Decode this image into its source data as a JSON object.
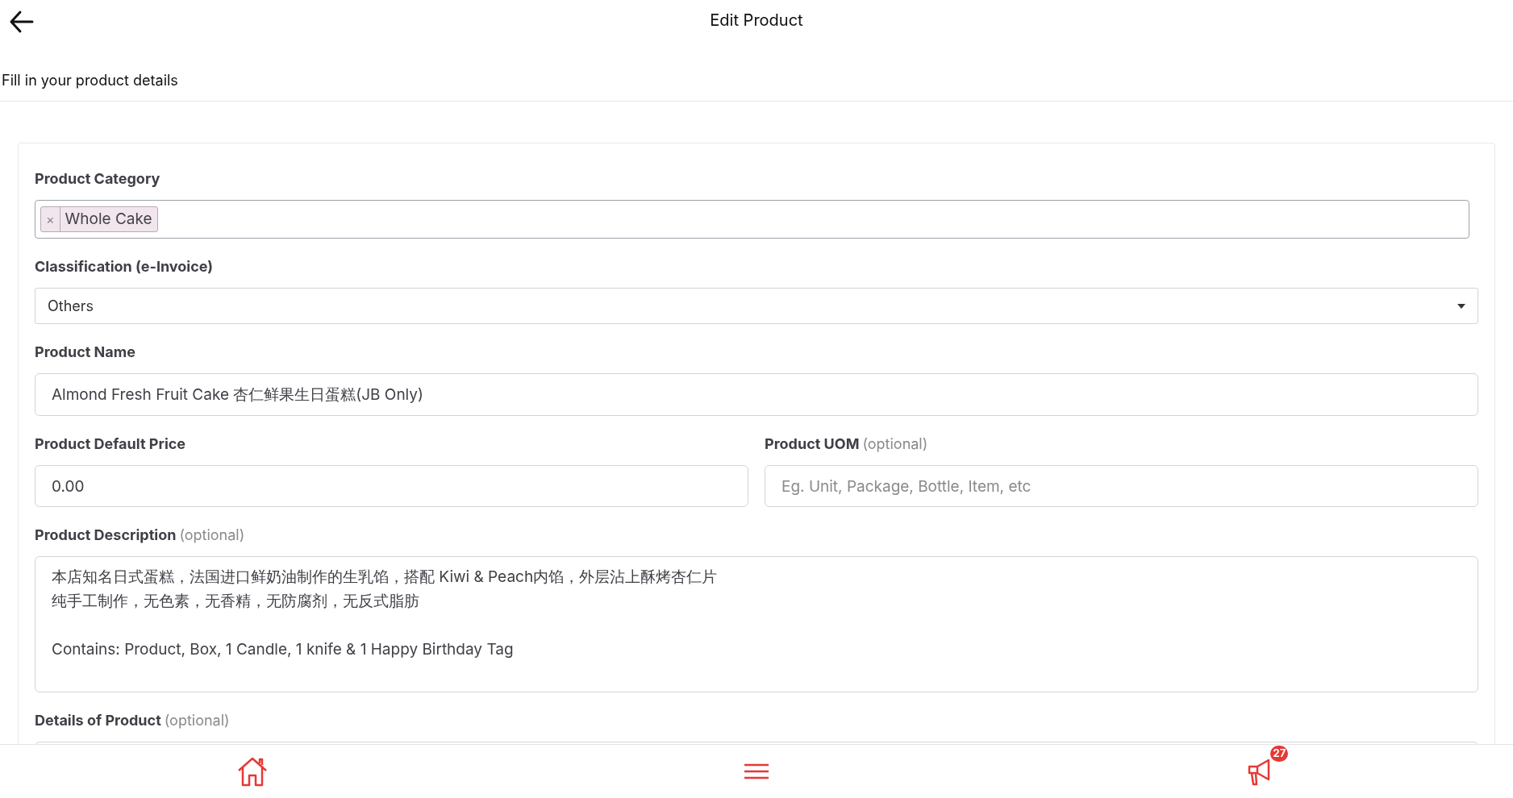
{
  "header": {
    "title": "Edit Product"
  },
  "subtitle": "Fill in your product details",
  "form": {
    "category": {
      "label": "Product Category",
      "tags": [
        {
          "label": "Whole Cake",
          "remove": "×"
        }
      ]
    },
    "classification": {
      "label": "Classification (e-Invoice)",
      "value": "Others"
    },
    "name": {
      "label": "Product Name",
      "value": "Almond Fresh Fruit Cake 杏仁鲜果生日蛋糕(JB Only)"
    },
    "price": {
      "label": "Product Default Price",
      "value": "0.00"
    },
    "uom": {
      "label": "Product UOM",
      "hint": "(optional)",
      "placeholder": "Eg. Unit, Package, Bottle, Item, etc"
    },
    "description": {
      "label": "Product Description",
      "hint": "(optional)",
      "paragraphs": [
        {
          "lines": [
            "本店知名日式蛋糕，法国进口鲜奶油制作的生乳馅，搭配 Kiwi & Peach内馅，外层沾上酥烤杏仁片",
            "纯手工制作，无色素，无香精，无防腐剂，无反式脂肪"
          ]
        },
        {
          "lines": [
            "Contains: Product, Box, 1 Candle, 1 knife & 1 Happy Birthday Tag"
          ]
        }
      ]
    },
    "details": {
      "label": "Details of Product",
      "hint": "(optional)"
    }
  },
  "nav": [
    {
      "kind": "home"
    },
    {
      "kind": "menu"
    },
    {
      "kind": "announcements",
      "badge": "27"
    }
  ]
}
